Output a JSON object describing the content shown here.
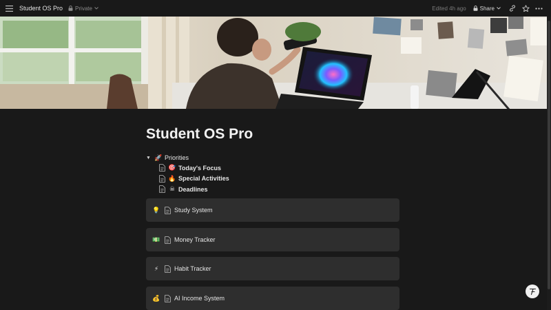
{
  "topbar": {
    "page_name": "Student OS Pro",
    "privacy": "Private",
    "edited": "Edited 4h ago",
    "share_label": "Share"
  },
  "cover": {
    "alt": "cover-photo-laptop-desk"
  },
  "page": {
    "title": "Student OS Pro",
    "toggle": {
      "label": "Priorities",
      "emoji": "🚀",
      "items": [
        {
          "emoji": "🎯",
          "label": "Today's Focus"
        },
        {
          "emoji": "🔥",
          "label": "Special Activities"
        },
        {
          "emoji": "☠",
          "label": "Deadlines"
        }
      ]
    },
    "cards": [
      {
        "emoji": "💡",
        "label": "Study System"
      },
      {
        "emoji": "💵",
        "label": "Money Tracker"
      },
      {
        "emoji": "⚡",
        "label": "Habit Tracker"
      },
      {
        "emoji": "💰",
        "label": "AI Income System"
      }
    ]
  },
  "colors": {
    "background": "#191919",
    "card": "#2e2e2e",
    "text": "#e6e6e6"
  }
}
